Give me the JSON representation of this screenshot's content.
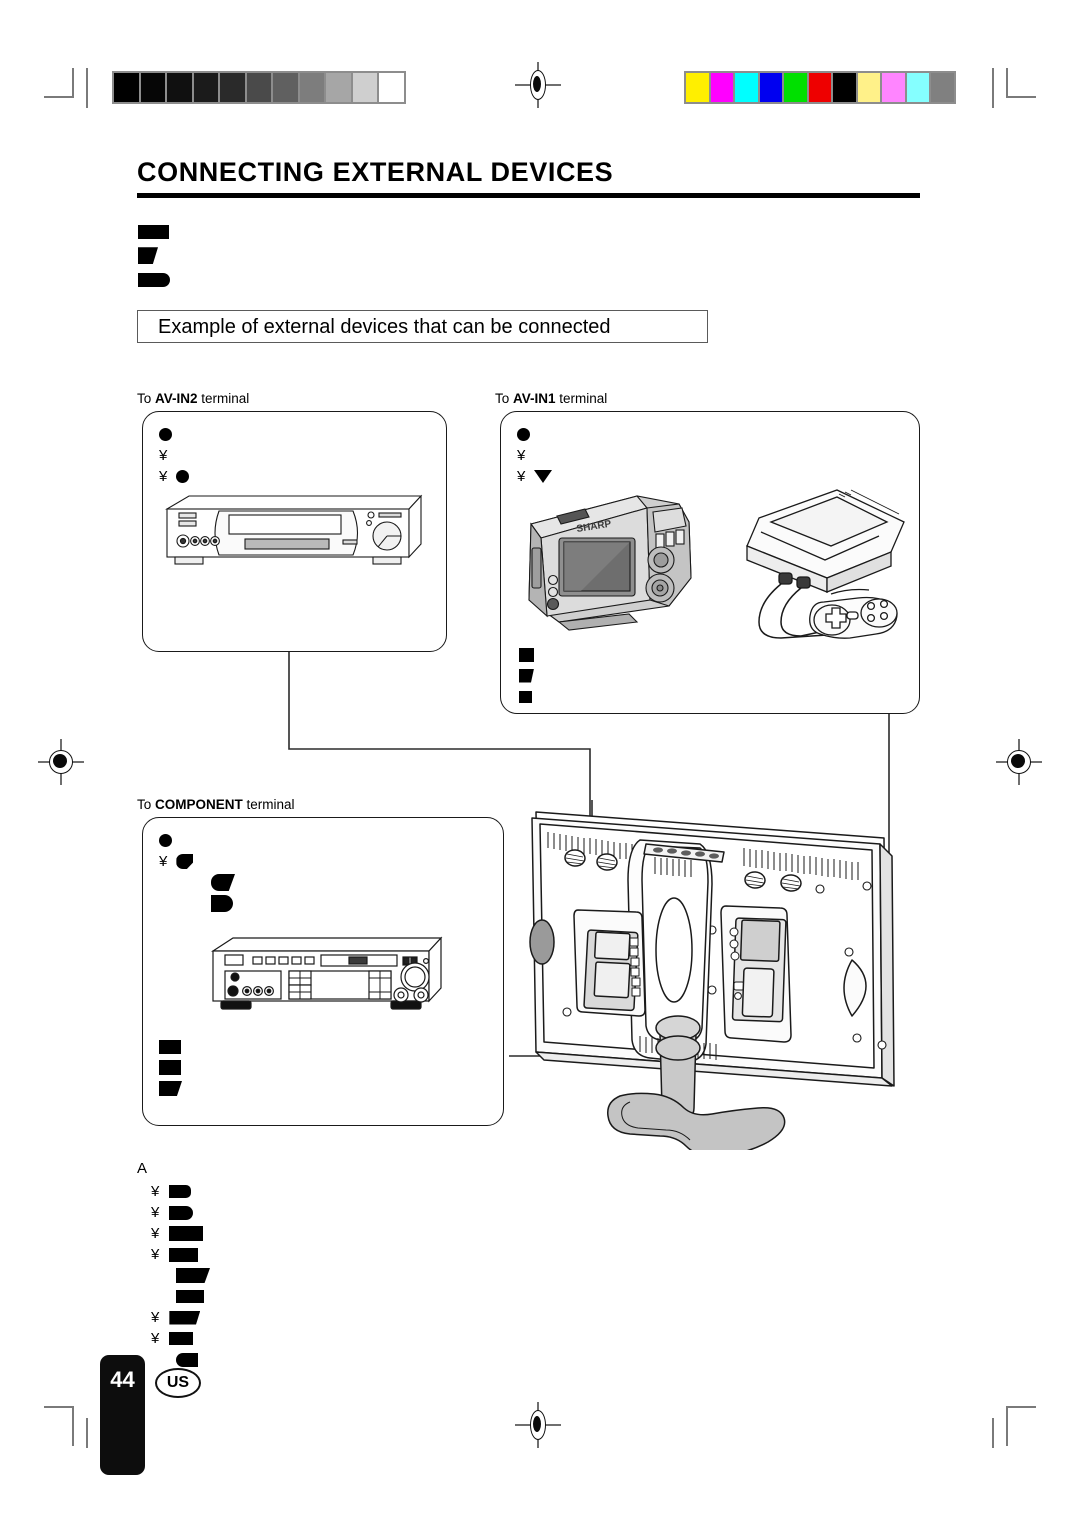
{
  "document": {
    "title": "CONNECTING EXTERNAL DEVICES",
    "section_heading": "Example of external devices that can be connected",
    "page_number": "44",
    "region_code": "US"
  },
  "intro_lines": [
    {
      "glyph": "black-box-wide"
    },
    {
      "glyph": "black-box-slanted"
    },
    {
      "glyph": "black-box-round-right"
    }
  ],
  "callouts": [
    {
      "id": "av-in2",
      "label_prefix": "To ",
      "label_term": "AV-IN2",
      "label_suffix": " terminal",
      "device": "vcr-illustration",
      "marks": [
        {
          "icons": [
            "bullet"
          ]
        },
        {
          "icons": [
            "yen"
          ]
        },
        {
          "icons": [
            "yen",
            "bullet"
          ]
        }
      ]
    },
    {
      "id": "av-in1",
      "label_prefix": "To ",
      "label_term": "AV-IN1",
      "label_suffix": " terminal",
      "device": "digital-camera-and-game-console-illustration",
      "marks": [
        {
          "icons": [
            "bullet"
          ]
        },
        {
          "icons": [
            "yen"
          ]
        },
        {
          "icons": [
            "yen",
            "triangle-down"
          ]
        }
      ],
      "footnote_glyphs": [
        "black-square",
        "black-square-slanted",
        "black-square"
      ]
    },
    {
      "id": "component",
      "label_prefix": "To ",
      "label_term": "COMPONENT",
      "label_suffix": " terminal",
      "device": "dvd-player-illustration",
      "marks": [
        {
          "icons": [
            "bullet"
          ]
        },
        {
          "icons": [
            "yen",
            "glyph-d"
          ]
        },
        {
          "icons": [
            "glyph-e"
          ]
        },
        {
          "icons": [
            "glyph-f"
          ]
        }
      ],
      "footnote_glyphs": [
        "black-box-wide",
        "black-box-wide",
        "black-box-slanted"
      ]
    }
  ],
  "main_device": {
    "name": "lcd-television-rear-view",
    "description": "Rear view of flat panel television on pedestal stand showing terminal panels"
  },
  "notes": {
    "heading": "A",
    "items": [
      {
        "bullet": "yen",
        "glyph": "box-sm"
      },
      {
        "bullet": "yen",
        "glyph": "box-round"
      },
      {
        "bullet": "yen",
        "glyph": "box-lg"
      },
      {
        "bullet": "yen",
        "glyph": "box-md"
      },
      {
        "bullet": "",
        "glyph": "box-slant"
      },
      {
        "bullet": "",
        "glyph": "box-md2"
      },
      {
        "bullet": "yen",
        "glyph": "box-slant2"
      },
      {
        "bullet": "yen",
        "glyph": "box-sm2"
      },
      {
        "bullet": "",
        "glyph": "box-round2"
      }
    ]
  },
  "prepress": {
    "grayscale_steps": [
      "#000000",
      "#060606",
      "#101010",
      "#1b1b1b",
      "#2a2a2a",
      "#4a4a4a",
      "#606060",
      "#7d7d7d",
      "#a6a6a6",
      "#cfcfcf",
      "#ffffff"
    ],
    "color_bars": [
      "#ffef00",
      "#ff00ff",
      "#00ffff",
      "#0000f0",
      "#00e000",
      "#ee0000",
      "#000000",
      "#fff189",
      "#ff85ff",
      "#85ffff",
      "#808080"
    ]
  }
}
